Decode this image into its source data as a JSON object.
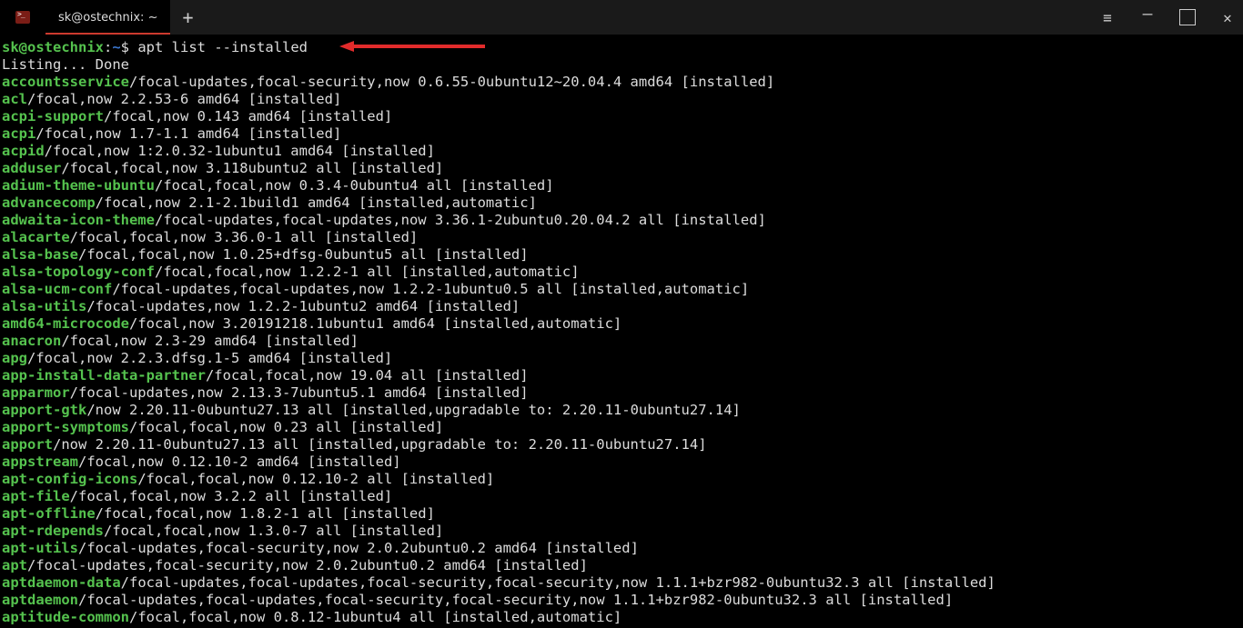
{
  "titlebar": {
    "tab_label": "sk@ostechnix: ~",
    "new_tab_glyph": "+",
    "menu_glyph": "≡",
    "minimize_glyph": "—",
    "close_glyph": "✕"
  },
  "prompt": {
    "user_host": "sk@ostechnix",
    "colon": ":",
    "cwd": "~",
    "dollar": "$ ",
    "command": "apt list --installed"
  },
  "listing_header": "Listing... Done",
  "packages": [
    {
      "name": "accountsservice",
      "rest": "/focal-updates,focal-security,now 0.6.55-0ubuntu12~20.04.4 amd64 [installed]"
    },
    {
      "name": "acl",
      "rest": "/focal,now 2.2.53-6 amd64 [installed]"
    },
    {
      "name": "acpi-support",
      "rest": "/focal,now 0.143 amd64 [installed]"
    },
    {
      "name": "acpi",
      "rest": "/focal,now 1.7-1.1 amd64 [installed]"
    },
    {
      "name": "acpid",
      "rest": "/focal,now 1:2.0.32-1ubuntu1 amd64 [installed]"
    },
    {
      "name": "adduser",
      "rest": "/focal,focal,now 3.118ubuntu2 all [installed]"
    },
    {
      "name": "adium-theme-ubuntu",
      "rest": "/focal,focal,now 0.3.4-0ubuntu4 all [installed]"
    },
    {
      "name": "advancecomp",
      "rest": "/focal,now 2.1-2.1build1 amd64 [installed,automatic]"
    },
    {
      "name": "adwaita-icon-theme",
      "rest": "/focal-updates,focal-updates,now 3.36.1-2ubuntu0.20.04.2 all [installed]"
    },
    {
      "name": "alacarte",
      "rest": "/focal,focal,now 3.36.0-1 all [installed]"
    },
    {
      "name": "alsa-base",
      "rest": "/focal,focal,now 1.0.25+dfsg-0ubuntu5 all [installed]"
    },
    {
      "name": "alsa-topology-conf",
      "rest": "/focal,focal,now 1.2.2-1 all [installed,automatic]"
    },
    {
      "name": "alsa-ucm-conf",
      "rest": "/focal-updates,focal-updates,now 1.2.2-1ubuntu0.5 all [installed,automatic]"
    },
    {
      "name": "alsa-utils",
      "rest": "/focal-updates,now 1.2.2-1ubuntu2 amd64 [installed]"
    },
    {
      "name": "amd64-microcode",
      "rest": "/focal,now 3.20191218.1ubuntu1 amd64 [installed,automatic]"
    },
    {
      "name": "anacron",
      "rest": "/focal,now 2.3-29 amd64 [installed]"
    },
    {
      "name": "apg",
      "rest": "/focal,now 2.2.3.dfsg.1-5 amd64 [installed]"
    },
    {
      "name": "app-install-data-partner",
      "rest": "/focal,focal,now 19.04 all [installed]"
    },
    {
      "name": "apparmor",
      "rest": "/focal-updates,now 2.13.3-7ubuntu5.1 amd64 [installed]"
    },
    {
      "name": "apport-gtk",
      "rest": "/now 2.20.11-0ubuntu27.13 all [installed,upgradable to: 2.20.11-0ubuntu27.14]"
    },
    {
      "name": "apport-symptoms",
      "rest": "/focal,focal,now 0.23 all [installed]"
    },
    {
      "name": "apport",
      "rest": "/now 2.20.11-0ubuntu27.13 all [installed,upgradable to: 2.20.11-0ubuntu27.14]"
    },
    {
      "name": "appstream",
      "rest": "/focal,now 0.12.10-2 amd64 [installed]"
    },
    {
      "name": "apt-config-icons",
      "rest": "/focal,focal,now 0.12.10-2 all [installed]"
    },
    {
      "name": "apt-file",
      "rest": "/focal,focal,now 3.2.2 all [installed]"
    },
    {
      "name": "apt-offline",
      "rest": "/focal,focal,now 1.8.2-1 all [installed]"
    },
    {
      "name": "apt-rdepends",
      "rest": "/focal,focal,now 1.3.0-7 all [installed]"
    },
    {
      "name": "apt-utils",
      "rest": "/focal-updates,focal-security,now 2.0.2ubuntu0.2 amd64 [installed]"
    },
    {
      "name": "apt",
      "rest": "/focal-updates,focal-security,now 2.0.2ubuntu0.2 amd64 [installed]"
    },
    {
      "name": "aptdaemon-data",
      "rest": "/focal-updates,focal-updates,focal-security,focal-security,now 1.1.1+bzr982-0ubuntu32.3 all [installed]"
    },
    {
      "name": "aptdaemon",
      "rest": "/focal-updates,focal-updates,focal-security,focal-security,now 1.1.1+bzr982-0ubuntu32.3 all [installed]"
    },
    {
      "name": "aptitude-common",
      "rest": "/focal,focal,now 0.8.12-1ubuntu4 all [installed,automatic]"
    }
  ],
  "annotation_arrow_color": "#e22b2b"
}
